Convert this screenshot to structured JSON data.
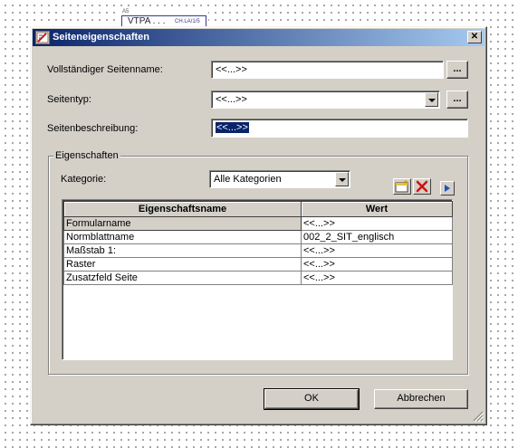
{
  "background": {
    "snippet_small": "A5",
    "snippet_label": "VTPA . . .",
    "snippet_tag": "CH.LA/1/5"
  },
  "dialog": {
    "title": "Seiteneigenschaften",
    "close_glyph": "✕",
    "fields": {
      "full_name": {
        "label": "Vollständiger Seitenname:",
        "value": "<<...>>",
        "browse": "..."
      },
      "page_type": {
        "label": "Seitentyp:",
        "value": "<<...>>",
        "browse": "..."
      },
      "description": {
        "label": "Seitenbeschreibung:",
        "value": "<<...>>"
      }
    },
    "properties_group": {
      "caption": "Eigenschaften",
      "category_label": "Kategorie:",
      "category_value": "Alle Kategorien",
      "columns": [
        "Eigenschaftsname",
        "Wert"
      ],
      "rows": [
        {
          "name": "Formularname",
          "value": "<<...>>"
        },
        {
          "name": "Normblattname",
          "value": "002_2_SIT_englisch"
        },
        {
          "name": "Maßstab 1:",
          "value": "<<...>>"
        },
        {
          "name": "Raster",
          "value": "<<...>>"
        },
        {
          "name": "Zusatzfeld Seite",
          "value": "<<...>>"
        }
      ],
      "icons": [
        "new-property-icon",
        "delete-icon",
        "play-arrow-icon"
      ]
    },
    "buttons": {
      "ok": "OK",
      "cancel": "Abbrechen"
    },
    "colors": {
      "titlebar_start": "#0a246a",
      "titlebar_end": "#a6caf0",
      "face": "#d4d0c8",
      "selection": "#0a246a",
      "delete_red": "#d01010"
    }
  }
}
